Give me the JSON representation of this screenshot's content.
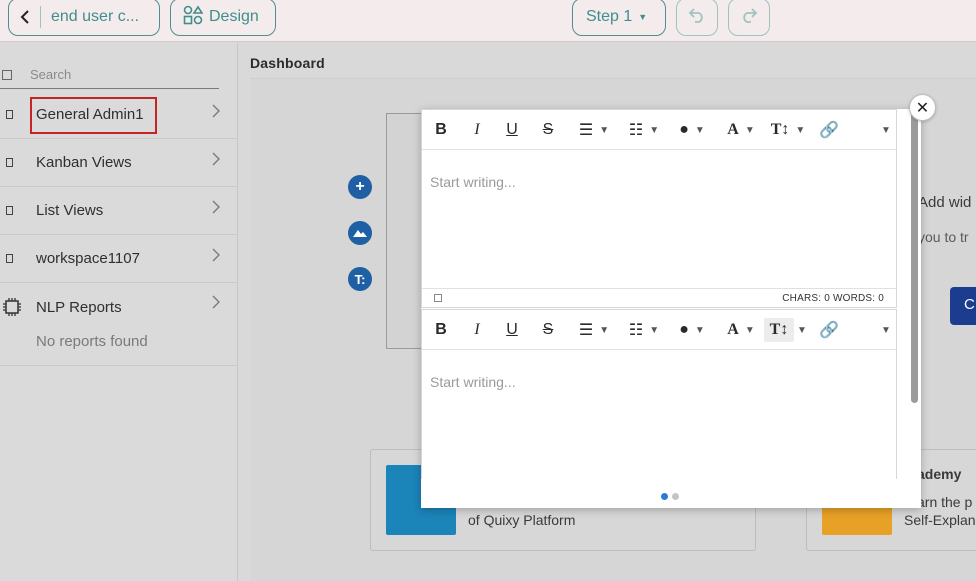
{
  "topbar": {
    "back_label": "end user c...",
    "design_label": "Design",
    "step_label": "Step 1"
  },
  "sidebar": {
    "search_placeholder": "Search",
    "items": [
      {
        "label": "General Admin1"
      },
      {
        "label": "Kanban Views"
      },
      {
        "label": "List Views"
      },
      {
        "label": "workspace1107"
      }
    ],
    "nlp": {
      "label": "NLP Reports",
      "empty": "No reports found"
    }
  },
  "main": {
    "title": "Dashboard",
    "peek_add": "Add wid",
    "peek_you": "you to tr",
    "peek_button": "C",
    "card_left_text": "of Quixy Platform",
    "card_right_title": "ademy",
    "card_right_line1": "arn the p",
    "card_right_line2": "Self-Explan"
  },
  "modal": {
    "editor1": {
      "placeholder": "Start writing...",
      "counts": "CHARS: 0   WORDS: 0"
    },
    "editor2": {
      "placeholder": "Start writing..."
    },
    "close_glyph": "✕"
  },
  "colors": {
    "accent": "#3f8e8b",
    "selected_outline": "#c42424",
    "fab": "#1f5fa3"
  }
}
